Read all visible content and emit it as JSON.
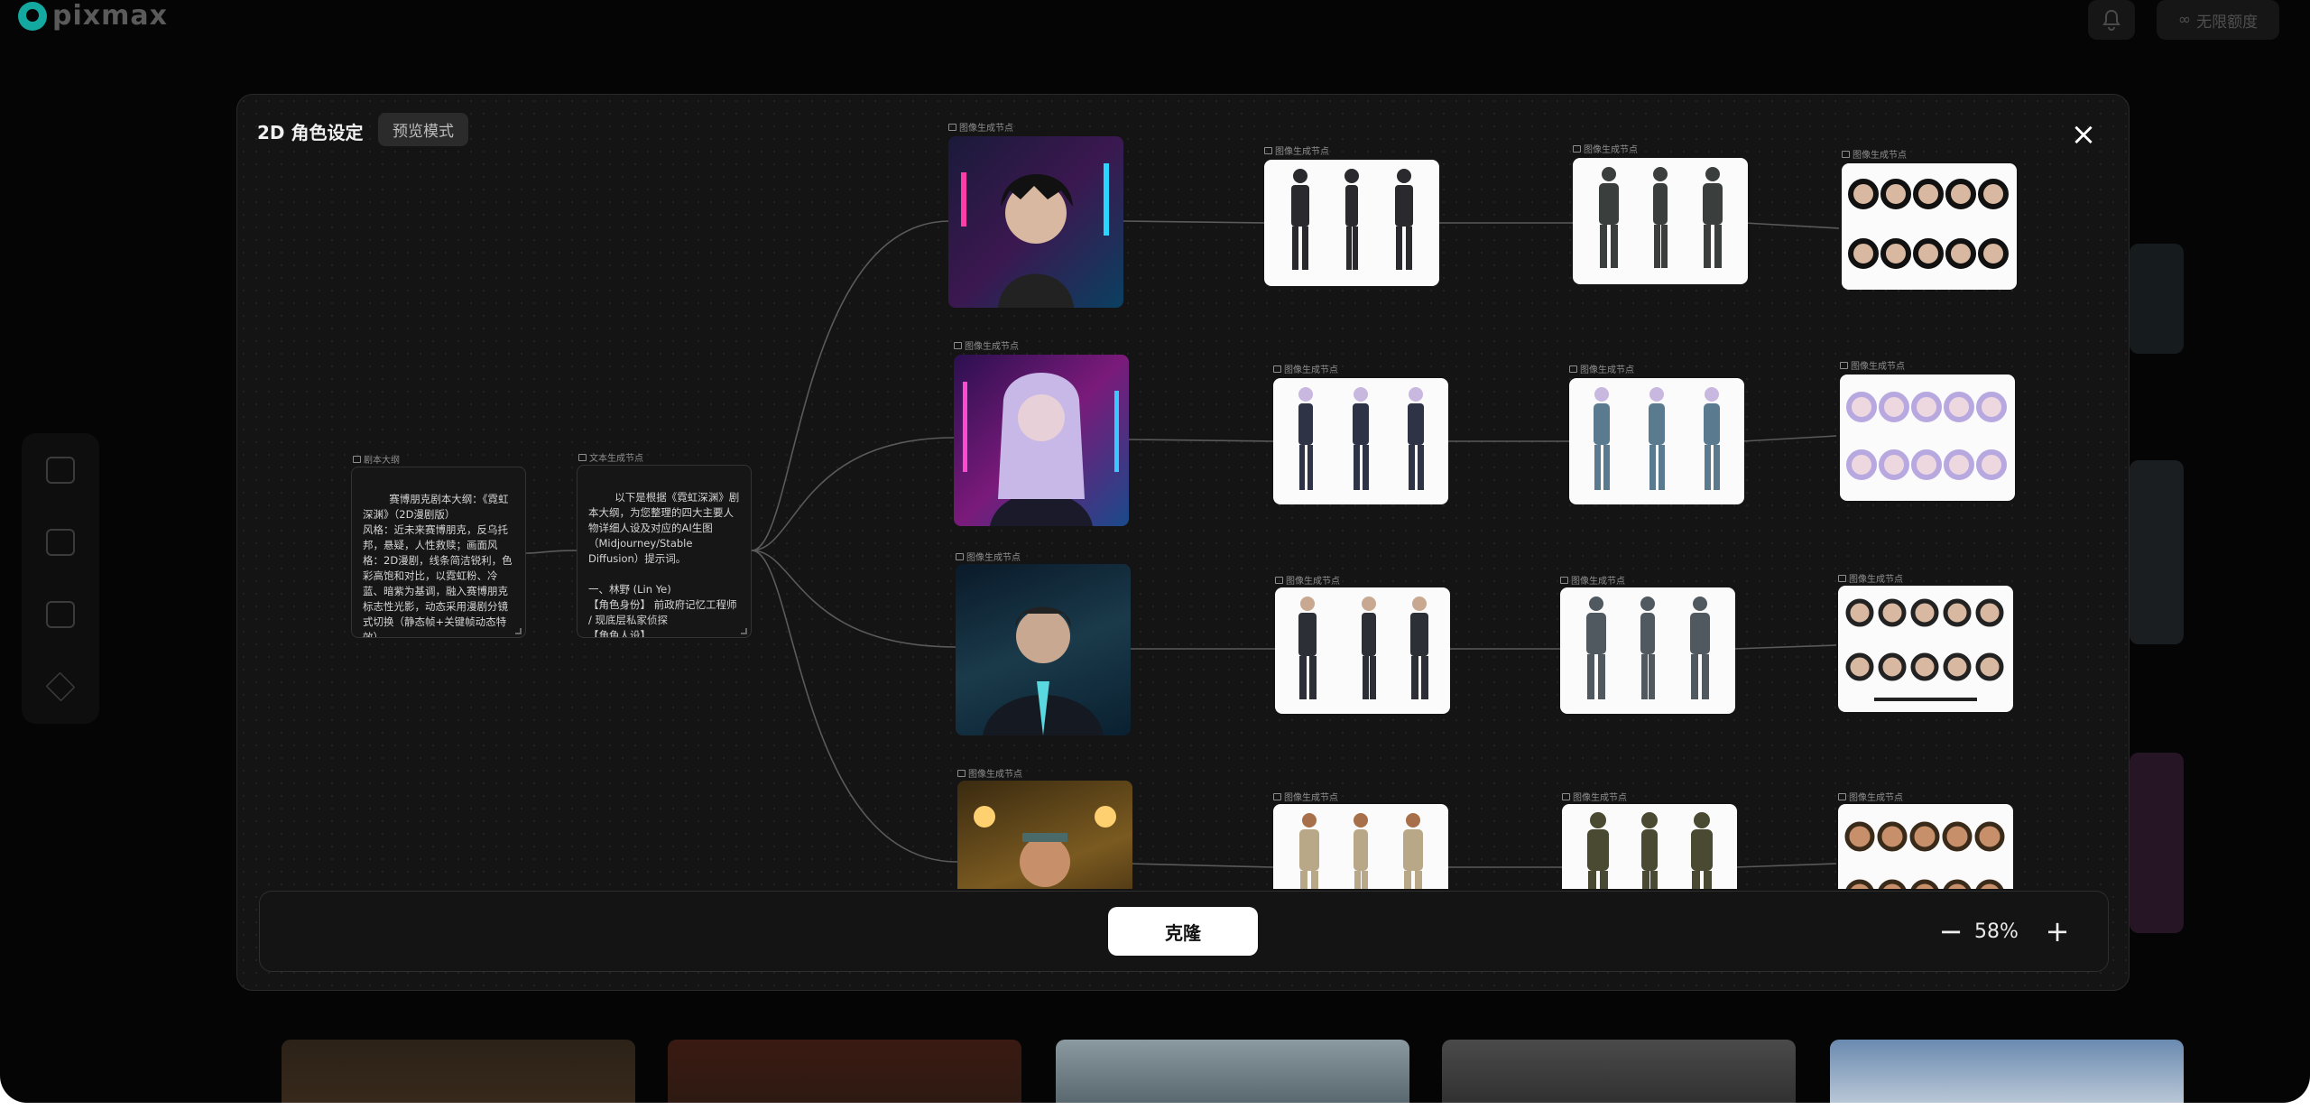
{
  "brand": {
    "name": "pixmax"
  },
  "topbar": {
    "unlimited_label": "无限额度",
    "unlimited_prefix": "∞"
  },
  "modal": {
    "title": "2D 角色设定",
    "mode_badge": "预览模式",
    "close_glyph": "×",
    "clone_label": "克隆",
    "zoom_minus": "−",
    "zoom_plus": "+",
    "zoom_value": "58%"
  },
  "nodes": {
    "script_outline": {
      "label": "剧本大纲",
      "text": "赛博朋克剧本大纲：《霓虹深渊》（2D漫剧版）\n风格：近未来赛博朋克，反乌托邦，悬疑，人性救赎；画面风格：2D漫剧，线条简洁锐利，色彩高饱和对比，以霓虹粉、冷蓝、暗紫为基调，融入赛博朋克标志性光影，动态采用漫剧分镜式切换（静态帧+关键帧动态特效）。"
    },
    "text_gen": {
      "label": "文本生成节点",
      "text": "以下是根据《霓虹深渊》剧本大纲，为您整理的四大主要人物详细人设及对应的AI生图（Midjourney/Stable Diffusion）提示词。\n\n一、林野 (Lin Ye)\n【角色身份】 前政府记忆工程师 / 现底层私家侦探\n【角色人设】"
    },
    "image_node_label": "图像生成节点"
  }
}
